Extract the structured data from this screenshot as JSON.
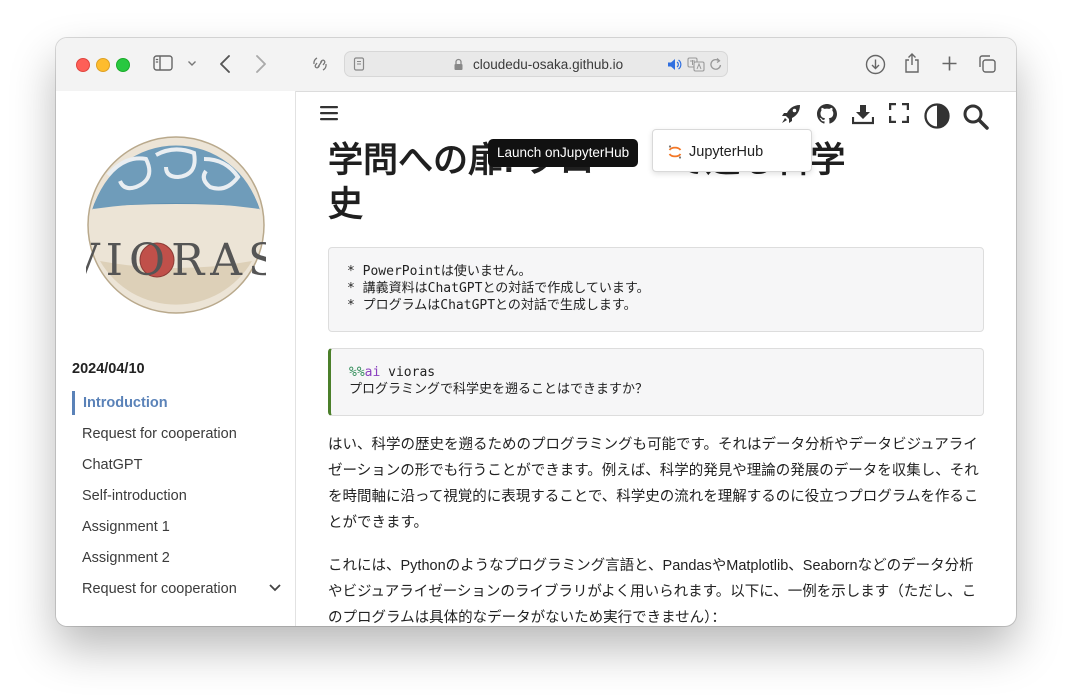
{
  "browser": {
    "address": "cloudedu-osaka.github.io"
  },
  "sidebar": {
    "date": "2024/04/10",
    "logo_text": "VIORAS",
    "items": [
      {
        "label": "Introduction"
      },
      {
        "label": "Request for cooperation"
      },
      {
        "label": "ChatGPT"
      },
      {
        "label": "Self-introduction"
      },
      {
        "label": "Assignment 1"
      },
      {
        "label": "Assignment 2"
      },
      {
        "label": "Request for cooperation"
      }
    ]
  },
  "header": {
    "icons": [
      "menu-icon",
      "rocket-icon",
      "github-icon",
      "download-icon",
      "fullscreen-icon",
      "theme-toggle-icon",
      "search-icon"
    ]
  },
  "page": {
    "title_start": "学問への扉",
    "title_middle": ": プロ",
    "title_end": "で遡る科学",
    "title_line2": "史",
    "code_block_1": [
      "* PowerPointは使いません。",
      "* 講義資料はChatGPTとの対話で作成しています。",
      "* プログラムはChatGPTとの対話で生成します。"
    ],
    "code_block_2": {
      "magic": "%%",
      "keyword": "ai",
      "arg": " vioras",
      "line2": "プログラミングで科学史を遡ることはできますか？"
    },
    "paragraph_1": "はい、科学の歴史を遡るためのプログラミングも可能です。それはデータ分析やデータビジュアライゼーションの形でも行うことができます。例えば、科学的発見や理論の発展のデータを収集し、それを時間軸に沿って視覚的に表現することで、科学史の流れを理解するのに役立つプログラムを作ることができます。",
    "paragraph_2": "これには、Pythonのようなプログラミング言語と、PandasやMatplotlib、Seabornなどのデータ分析やビジュアライゼーションのライブラリがよく用いられます。以下に、一例を示します（ただし、このプログラムは具体的なデータがないため実行できません）："
  },
  "tooltip": {
    "text": "Launch onJupyterHub"
  },
  "dropdown": {
    "item": "JupyterHub"
  },
  "colors": {
    "accent": "#5a82b8",
    "code_border": "#4b7f2a",
    "tooltip_bg": "#111111"
  }
}
